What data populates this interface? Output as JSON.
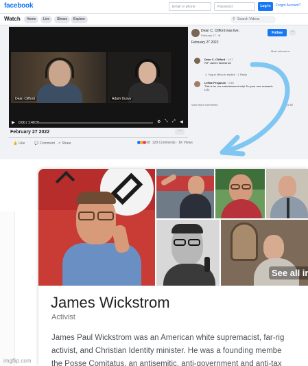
{
  "facebook": {
    "logo": "facebook",
    "email_placeholder": "Email or phone",
    "password_placeholder": "Password",
    "login_label": "Log In",
    "forgot_label": "Forgot Account?",
    "section_title": "Watch",
    "tabs": [
      "Home",
      "Live",
      "Shows",
      "Explore"
    ],
    "search_placeholder": "Search Videos",
    "video": {
      "participants": [
        "Dean Clifford",
        "Adam Dusvy"
      ],
      "time": "0:00 / 1:40:01",
      "progress": 0
    },
    "post_date": "February 27 2022",
    "actions": [
      "Like",
      "Comment",
      "Share"
    ],
    "reactions_count": "68",
    "comments_count": "128 Comments",
    "views_count": "1K Views",
    "author": {
      "name": "Dean C. Clifford was live.",
      "date": "February 27 · ⊕"
    },
    "follow_label": "Follow",
    "post_subtitle": "February 27 2022",
    "sort_label": "Most relevant ▾",
    "comments": [
      {
        "name": "Dean C. Clifford",
        "time": "· 1:37",
        "text": "RIP James Wickstrom"
      },
      {
        "name": "LeHae Ferguson",
        "time": "· 1:46",
        "text": "This is for our entertainment only! Do your own research LOL"
      }
    ],
    "reply_meta": "Vogue Mihcold replied · 1 Reply",
    "view_more": "View more comments",
    "page_count": "3 of 82"
  },
  "knowledge_panel": {
    "see_all": "See all im",
    "name": "James Wickstrom",
    "subtitle": "Activist",
    "description": [
      "James Paul Wickstrom was an American white supremacist, far-rig",
      "activist, and Christian Identity minister. He was a founding membe",
      "the Posse Comitatus, an antisemitic, anti-government and anti-tax"
    ]
  },
  "watermark": "imgflip.com",
  "colors": {
    "facebook_blue": "#1877f2",
    "arrow": "#7fc6f2",
    "flag_red": "#c8262b"
  }
}
